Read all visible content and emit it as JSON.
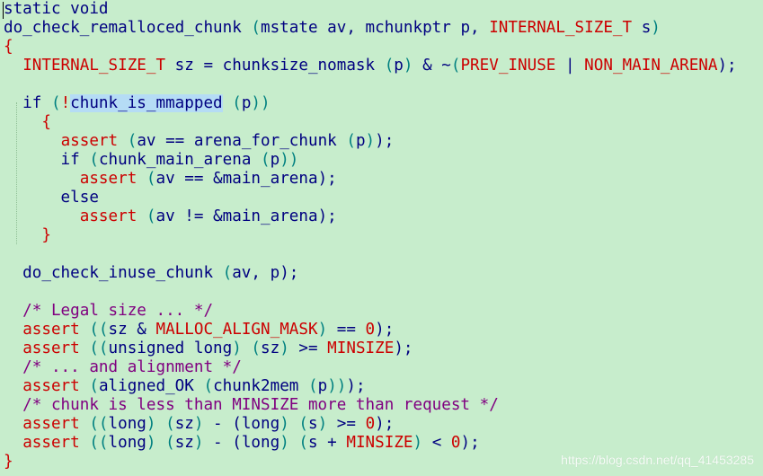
{
  "colors": {
    "background": "#c7edcc",
    "identifier": "#000080",
    "macro": "#cc0000",
    "paren": "#008080",
    "comment": "#800080",
    "highlight": "#b5dcf5",
    "watermark": "#ffffff"
  },
  "lines": [
    [
      {
        "t": "static void",
        "c": "identifier"
      }
    ],
    [
      {
        "t": "do_check_remalloced_chunk ",
        "c": "identifier"
      },
      {
        "t": "(",
        "c": "paren"
      },
      {
        "t": "mstate av, mchunkptr p, ",
        "c": "identifier"
      },
      {
        "t": "INTERNAL_SIZE_T",
        "c": "macro"
      },
      {
        "t": " s",
        "c": "identifier"
      },
      {
        "t": ")",
        "c": "paren"
      }
    ],
    [
      {
        "t": "{",
        "c": "macro"
      }
    ],
    [
      {
        "t": "  ",
        "c": "identifier"
      },
      {
        "t": "INTERNAL_SIZE_T",
        "c": "macro"
      },
      {
        "t": " sz = chunksize_nomask ",
        "c": "identifier"
      },
      {
        "t": "(",
        "c": "paren"
      },
      {
        "t": "p",
        "c": "identifier"
      },
      {
        "t": ")",
        "c": "paren"
      },
      {
        "t": " & ~",
        "c": "identifier"
      },
      {
        "t": "(",
        "c": "paren"
      },
      {
        "t": "PREV_INUSE",
        "c": "macro"
      },
      {
        "t": " | ",
        "c": "identifier"
      },
      {
        "t": "NON_MAIN_ARENA",
        "c": "macro"
      },
      {
        "t": ");",
        "c": "identifier"
      }
    ],
    [],
    [
      {
        "t": "  if ",
        "c": "identifier"
      },
      {
        "t": "(",
        "c": "paren"
      },
      {
        "t": "!",
        "c": "macro"
      },
      {
        "t": "chunk_is_mmapped",
        "c": "identifier",
        "hl": true
      },
      {
        "t": " (",
        "c": "paren"
      },
      {
        "t": "p",
        "c": "identifier"
      },
      {
        "t": ")",
        "c": "paren"
      },
      {
        "t": ")",
        "c": "paren"
      }
    ],
    [
      {
        "t": "    {",
        "c": "macro"
      }
    ],
    [
      {
        "t": "      ",
        "c": "identifier"
      },
      {
        "t": "assert",
        "c": "macro"
      },
      {
        "t": " (",
        "c": "paren"
      },
      {
        "t": "av == arena_for_chunk ",
        "c": "identifier"
      },
      {
        "t": "(",
        "c": "paren"
      },
      {
        "t": "p",
        "c": "identifier"
      },
      {
        "t": ")",
        "c": "paren"
      },
      {
        "t": ");",
        "c": "identifier"
      }
    ],
    [
      {
        "t": "      if ",
        "c": "identifier"
      },
      {
        "t": "(",
        "c": "paren"
      },
      {
        "t": "chunk_main_arena ",
        "c": "identifier"
      },
      {
        "t": "(",
        "c": "paren"
      },
      {
        "t": "p",
        "c": "identifier"
      },
      {
        "t": ")",
        "c": "paren"
      },
      {
        "t": ")",
        "c": "paren"
      }
    ],
    [
      {
        "t": "        ",
        "c": "identifier"
      },
      {
        "t": "assert",
        "c": "macro"
      },
      {
        "t": " (",
        "c": "paren"
      },
      {
        "t": "av == &main_arena",
        "c": "identifier"
      },
      {
        "t": ");",
        "c": "identifier"
      }
    ],
    [
      {
        "t": "      else",
        "c": "identifier"
      }
    ],
    [
      {
        "t": "        ",
        "c": "identifier"
      },
      {
        "t": "assert",
        "c": "macro"
      },
      {
        "t": " (",
        "c": "paren"
      },
      {
        "t": "av != &main_arena",
        "c": "identifier"
      },
      {
        "t": ");",
        "c": "identifier"
      }
    ],
    [
      {
        "t": "    }",
        "c": "macro"
      }
    ],
    [],
    [
      {
        "t": "  do_check_inuse_chunk ",
        "c": "identifier"
      },
      {
        "t": "(",
        "c": "paren"
      },
      {
        "t": "av, p",
        "c": "identifier"
      },
      {
        "t": ");",
        "c": "identifier"
      }
    ],
    [],
    [
      {
        "t": "  /* Legal size ... */",
        "c": "comment"
      }
    ],
    [
      {
        "t": "  ",
        "c": "identifier"
      },
      {
        "t": "assert",
        "c": "macro"
      },
      {
        "t": " ((",
        "c": "paren"
      },
      {
        "t": "sz & ",
        "c": "identifier"
      },
      {
        "t": "MALLOC_ALIGN_MASK",
        "c": "macro"
      },
      {
        "t": ")",
        "c": "paren"
      },
      {
        "t": " == ",
        "c": "identifier"
      },
      {
        "t": "0",
        "c": "macro"
      },
      {
        "t": ");",
        "c": "identifier"
      }
    ],
    [
      {
        "t": "  ",
        "c": "identifier"
      },
      {
        "t": "assert",
        "c": "macro"
      },
      {
        "t": " ((",
        "c": "paren"
      },
      {
        "t": "unsigned long",
        "c": "identifier"
      },
      {
        "t": ")",
        "c": "paren"
      },
      {
        "t": " (",
        "c": "paren"
      },
      {
        "t": "sz",
        "c": "identifier"
      },
      {
        "t": ")",
        "c": "paren"
      },
      {
        "t": " >= ",
        "c": "identifier"
      },
      {
        "t": "MINSIZE",
        "c": "macro"
      },
      {
        "t": ");",
        "c": "identifier"
      }
    ],
    [
      {
        "t": "  /* ... and alignment */",
        "c": "comment"
      }
    ],
    [
      {
        "t": "  ",
        "c": "identifier"
      },
      {
        "t": "assert",
        "c": "macro"
      },
      {
        "t": " (",
        "c": "paren"
      },
      {
        "t": "aligned_OK ",
        "c": "identifier"
      },
      {
        "t": "(",
        "c": "paren"
      },
      {
        "t": "chunk2mem ",
        "c": "identifier"
      },
      {
        "t": "(",
        "c": "paren"
      },
      {
        "t": "p",
        "c": "identifier"
      },
      {
        "t": ")",
        "c": "paren"
      },
      {
        "t": ")",
        "c": "paren"
      },
      {
        "t": ");",
        "c": "identifier"
      }
    ],
    [
      {
        "t": "  /* chunk is less than MINSIZE more than request */",
        "c": "comment"
      }
    ],
    [
      {
        "t": "  ",
        "c": "identifier"
      },
      {
        "t": "assert",
        "c": "macro"
      },
      {
        "t": " ((",
        "c": "paren"
      },
      {
        "t": "long",
        "c": "identifier"
      },
      {
        "t": ")",
        "c": "paren"
      },
      {
        "t": " (",
        "c": "paren"
      },
      {
        "t": "sz",
        "c": "identifier"
      },
      {
        "t": ")",
        "c": "paren"
      },
      {
        "t": " - (",
        "c": "identifier"
      },
      {
        "t": "long",
        "c": "identifier"
      },
      {
        "t": ")",
        "c": "paren"
      },
      {
        "t": " (",
        "c": "paren"
      },
      {
        "t": "s",
        "c": "identifier"
      },
      {
        "t": ")",
        "c": "paren"
      },
      {
        "t": " >= ",
        "c": "identifier"
      },
      {
        "t": "0",
        "c": "macro"
      },
      {
        "t": ");",
        "c": "identifier"
      }
    ],
    [
      {
        "t": "  ",
        "c": "identifier"
      },
      {
        "t": "assert",
        "c": "macro"
      },
      {
        "t": " ((",
        "c": "paren"
      },
      {
        "t": "long",
        "c": "identifier"
      },
      {
        "t": ")",
        "c": "paren"
      },
      {
        "t": " (",
        "c": "paren"
      },
      {
        "t": "sz",
        "c": "identifier"
      },
      {
        "t": ")",
        "c": "paren"
      },
      {
        "t": " - (",
        "c": "identifier"
      },
      {
        "t": "long",
        "c": "identifier"
      },
      {
        "t": ")",
        "c": "paren"
      },
      {
        "t": " (",
        "c": "paren"
      },
      {
        "t": "s + ",
        "c": "identifier"
      },
      {
        "t": "MINSIZE",
        "c": "macro"
      },
      {
        "t": ")",
        "c": "paren"
      },
      {
        "t": " < ",
        "c": "identifier"
      },
      {
        "t": "0",
        "c": "macro"
      },
      {
        "t": ");",
        "c": "identifier"
      }
    ],
    [
      {
        "t": "}",
        "c": "macro"
      }
    ]
  ],
  "watermark": "https://blog.csdn.net/qq_41453285"
}
